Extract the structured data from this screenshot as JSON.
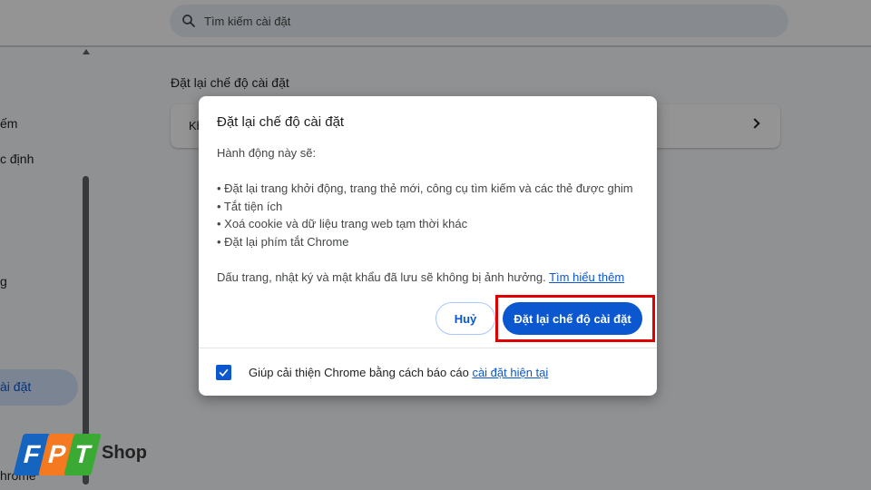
{
  "search": {
    "placeholder": "Tìm kiếm cài đặt"
  },
  "sidebar": {
    "items": [
      "ếm",
      "c định",
      "g",
      "ài đặt",
      "hrome"
    ],
    "active_label": "ài đặt"
  },
  "main": {
    "section_title": "Đặt lại chế độ cài đặt",
    "card_text": "Kh"
  },
  "dialog": {
    "title": "Đặt lại chế độ cài đặt",
    "intro": "Hành động này sẽ:",
    "bullets": [
      "• Đặt lại trang khởi động, trang thẻ mới, công cụ tìm kiếm và các thẻ được ghim",
      "• Tắt tiện ích",
      "• Xoá cookie và dữ liệu trang web tạm thời khác",
      "• Đặt lại phím tắt Chrome"
    ],
    "note": "Dấu trang, nhật ký và mật khẩu đã lưu sẽ không bị ảnh hưởng.",
    "note_link": "Tìm hiểu thêm",
    "cancel_label": "Huỷ",
    "reset_label": "Đặt lại chế độ cài đặt",
    "checkbox_checked": true,
    "checkbox_label": "Giúp cải thiện Chrome bằng cách báo cáo",
    "checkbox_link": "cài đặt hiện tại"
  },
  "watermark": {
    "letters": [
      "F",
      "P",
      "T"
    ],
    "shop": "Shop"
  },
  "colors": {
    "accent": "#0b57d0",
    "highlight": "#e00000",
    "logo_blue": "#1565c0",
    "logo_orange": "#f47920",
    "logo_green": "#3aaa35"
  }
}
